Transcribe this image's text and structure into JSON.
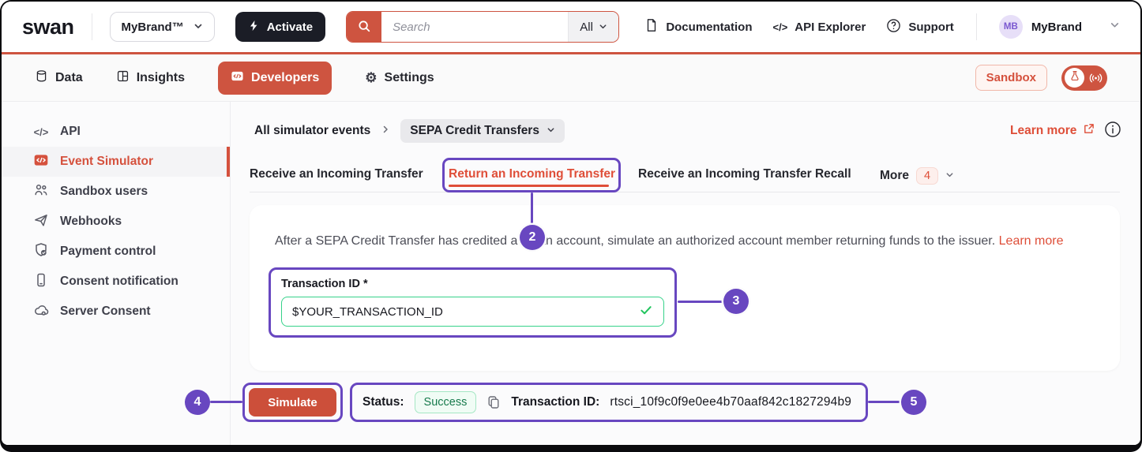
{
  "topbar": {
    "logo": "swan",
    "org_selector": {
      "label": "MyBrand™"
    },
    "activate": {
      "label": "Activate"
    },
    "search": {
      "placeholder": "Search",
      "scope": "All"
    },
    "links": {
      "documentation": "Documentation",
      "api_explorer": "API Explorer",
      "support": "Support"
    },
    "account": {
      "initials": "MB",
      "name": "MyBrand"
    }
  },
  "nav": {
    "data": "Data",
    "insights": "Insights",
    "developers": "Developers",
    "settings": "Settings",
    "sandbox_badge": "Sandbox"
  },
  "sidebar": {
    "items": [
      {
        "label": "API"
      },
      {
        "label": "Event Simulator",
        "active": true
      },
      {
        "label": "Sandbox users"
      },
      {
        "label": "Webhooks"
      },
      {
        "label": "Payment control"
      },
      {
        "label": "Consent notification"
      },
      {
        "label": "Server Consent"
      }
    ]
  },
  "main": {
    "breadcrumb": {
      "root": "All simulator events",
      "current": "SEPA Credit Transfers"
    },
    "learn_more": "Learn more",
    "tabs": [
      {
        "label": "Receive an Incoming Transfer"
      },
      {
        "label": "Return an Incoming Transfer",
        "active": true
      },
      {
        "label": "Receive an Incoming Transfer Recall"
      },
      {
        "label": "More",
        "badge": "4"
      }
    ],
    "description": "After a SEPA Credit Transfer has credited a Swan account, simulate an authorized account member returning funds to the issuer.",
    "description_link": "Learn more",
    "form": {
      "label": "Transaction ID *",
      "value": "$YOUR_TRANSACTION_ID"
    },
    "simulate": "Simulate",
    "result": {
      "status_label": "Status:",
      "status_value": "Success",
      "txid_label": "Transaction ID:",
      "txid_value": "rtsci_10f9c0f9e0ee4b70aaf842c1827294b9"
    }
  },
  "annotations": {
    "step2": "2",
    "step3": "3",
    "step4": "4",
    "step5": "5"
  },
  "colors": {
    "accent": "#ce5440",
    "accent_text": "#de4e38",
    "annotation": "#6847c0",
    "success": "#177a4c",
    "dark": "#1b1d26"
  },
  "icons": {
    "gear": "⚙",
    "code": "</>"
  }
}
